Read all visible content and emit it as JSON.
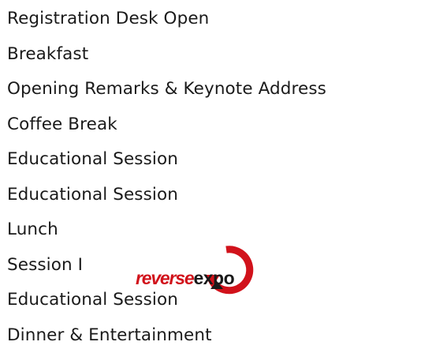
{
  "agenda": {
    "items": [
      "Registration Desk Open",
      "Breakfast",
      "Opening Remarks & Keynote Address",
      "Coffee Break",
      "Educational Session",
      "Educational Session",
      "Lunch",
      "Session I",
      "Educational Session",
      "Dinner & Entertainment"
    ]
  },
  "logo": {
    "word_red": "reverse",
    "word_dark": "expo",
    "colors": {
      "red": "#d1121b",
      "dark": "#1a1a1a"
    }
  }
}
